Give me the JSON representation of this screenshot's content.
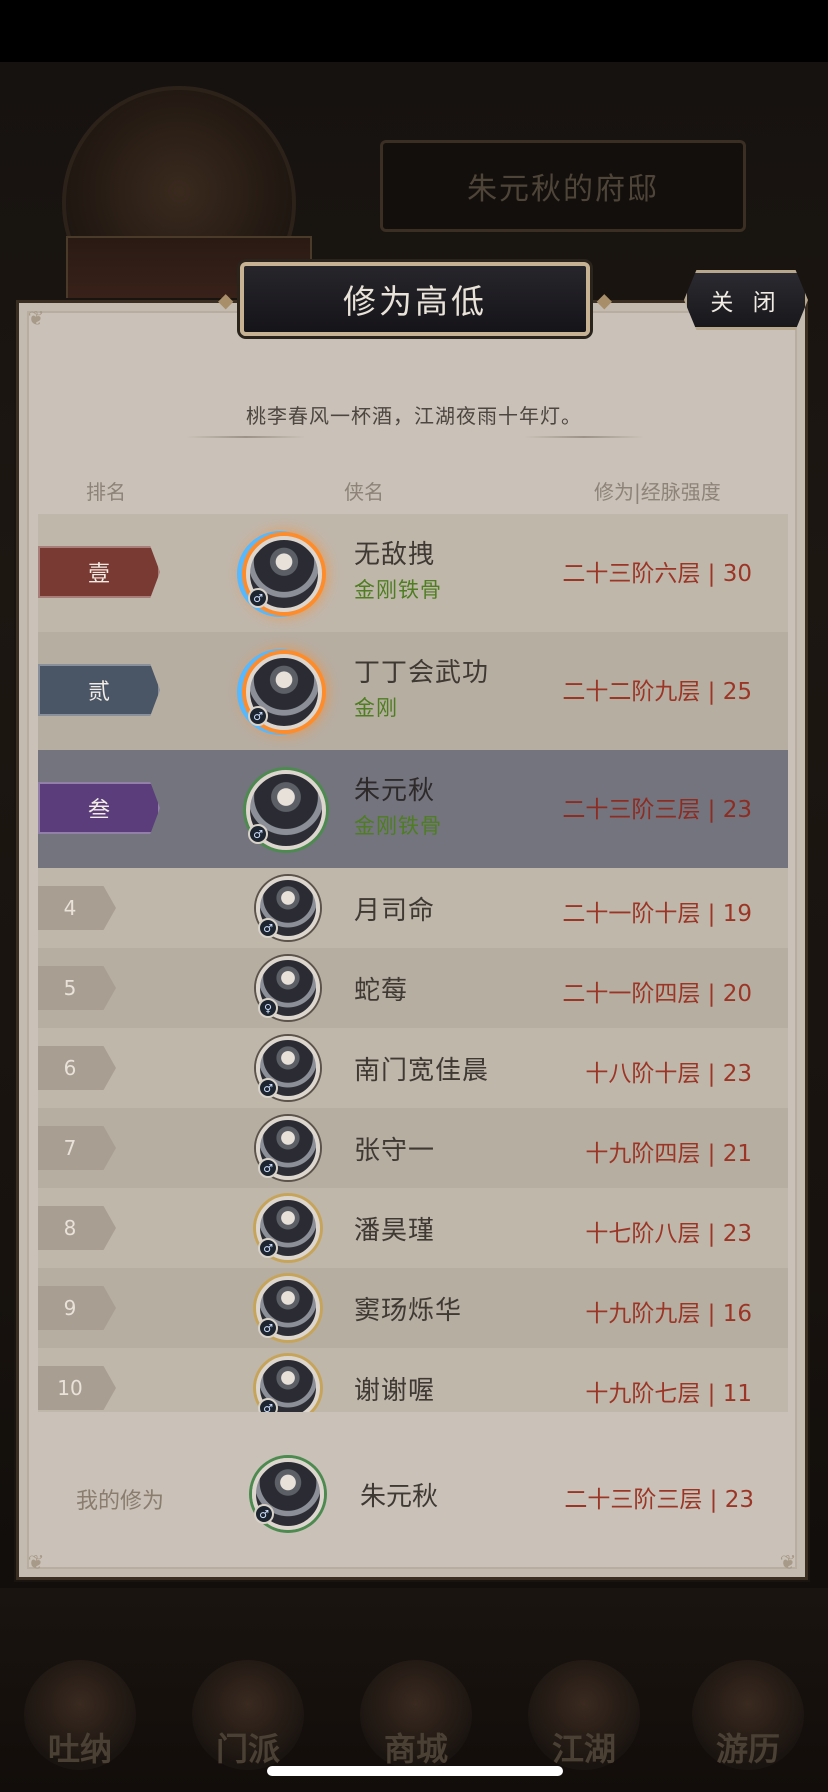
{
  "background": {
    "house_title": "朱元秋的府邸",
    "bottom_buttons": [
      "吐纳",
      "门派",
      "商城",
      "江湖",
      "游历"
    ]
  },
  "modal": {
    "title": "修为高低",
    "close_label": "关 闭",
    "poem": "桃李春风一杯酒，江湖夜雨十年灯。",
    "columns": {
      "rank": "排名",
      "name": "侠名",
      "value": "修为|经脉强度"
    },
    "rows": [
      {
        "rank": "壹",
        "name": "无敌拽",
        "title": "金刚铁骨",
        "value": "二十三阶六层 | 30"
      },
      {
        "rank": "贰",
        "name": "丁丁会武功",
        "title": "金刚",
        "value": "二十二阶九层 | 25"
      },
      {
        "rank": "叁",
        "name": "朱元秋",
        "title": "金刚铁骨",
        "value": "二十三阶三层 | 23"
      },
      {
        "rank": "4",
        "name": "月司命",
        "title": "",
        "value": "二十一阶十层 | 19"
      },
      {
        "rank": "5",
        "name": "蛇莓",
        "title": "",
        "value": "二十一阶四层 | 20"
      },
      {
        "rank": "6",
        "name": "南门宽佳晨",
        "title": "",
        "value": "十八阶十层 | 23"
      },
      {
        "rank": "7",
        "name": "张守一",
        "title": "",
        "value": "十九阶四层 | 21"
      },
      {
        "rank": "8",
        "name": "潘昊瑾",
        "title": "",
        "value": "十七阶八层 | 23"
      },
      {
        "rank": "9",
        "name": "窦玚烁华",
        "title": "",
        "value": "十九阶九层 | 16"
      },
      {
        "rank": "10",
        "name": "谢谢喔",
        "title": "",
        "value": "十九阶七层 | 11"
      }
    ],
    "my_entry": {
      "label": "我的修为",
      "name": "朱元秋",
      "value": "二十三阶三层 | 23"
    }
  },
  "colors": {
    "rank1": "#7a3a34",
    "rank2": "#4a5566",
    "rank3": "#5a3d7a",
    "value_text": "#9b3526",
    "title_text": "#4e7d22",
    "highlight_row": "#74747e"
  },
  "icons": [
    "male-gender-icon",
    "corner-ornament-icon",
    "fire-aura-frame-icon"
  ]
}
